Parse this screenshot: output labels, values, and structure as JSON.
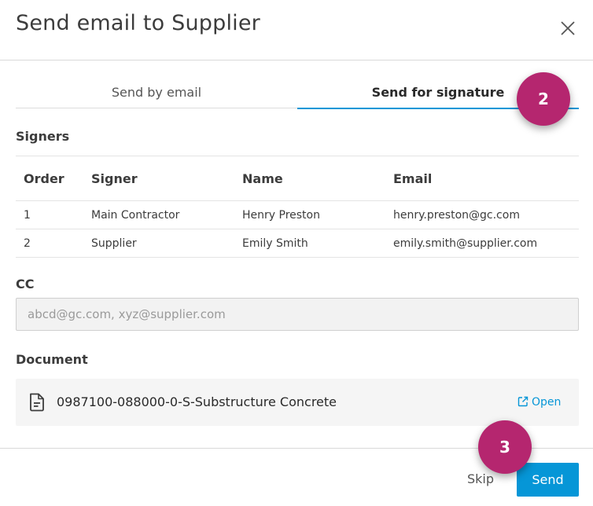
{
  "dialog": {
    "title": "Send email to Supplier",
    "close_icon": "close-icon"
  },
  "tabs": [
    {
      "label": "Send by email",
      "active": false
    },
    {
      "label": "Send for signature",
      "active": true
    }
  ],
  "badges": {
    "step2": "2",
    "step3": "3"
  },
  "signers": {
    "label": "Signers",
    "columns": [
      "Order",
      "Signer",
      "Name",
      "Email"
    ],
    "rows": [
      {
        "order": "1",
        "signer": "Main Contractor",
        "name": "Henry Preston",
        "email": "henry.preston@gc.com"
      },
      {
        "order": "2",
        "signer": "Supplier",
        "name": "Emily Smith",
        "email": "emily.smith@supplier.com"
      }
    ]
  },
  "cc": {
    "label": "CC",
    "value": "",
    "placeholder": "abcd@gc.com, xyz@supplier.com"
  },
  "document": {
    "label": "Document",
    "name": "0987100-088000-0-S-Substructure Concrete",
    "icon": "document-icon",
    "open_label": "Open",
    "open_icon": "external-link-icon"
  },
  "footer": {
    "skip_label": "Skip",
    "send_label": "Send"
  },
  "colors": {
    "accent": "#0696d7",
    "badge": "#b5266f"
  }
}
